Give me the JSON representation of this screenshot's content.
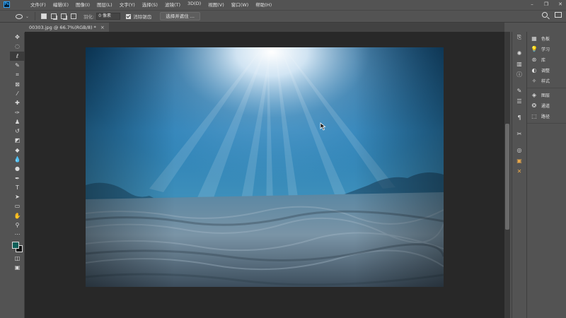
{
  "menu": {
    "app_logo": "Ps",
    "items": [
      "文件(F)",
      "编辑(E)",
      "图像(I)",
      "图层(L)",
      "文字(Y)",
      "选择(S)",
      "滤镜(T)",
      "3D(D)",
      "视图(V)",
      "窗口(W)",
      "帮助(H)"
    ]
  },
  "options": {
    "feather_label": "羽化:",
    "feather_value": "0 像素",
    "antialias_label": "消除锯齿",
    "antialias_checked": true,
    "select_mask_label": "选择并遮住 ..."
  },
  "document": {
    "tab_title": "00303.jpg @ 66.7%(RGB/8) *"
  },
  "panels": {
    "group1": [
      {
        "icon": "grid-icon",
        "label": "色板"
      },
      {
        "icon": "lightbulb-icon",
        "label": "学习"
      },
      {
        "icon": "library-icon",
        "label": "库"
      },
      {
        "icon": "adjustments-icon",
        "label": "调整"
      },
      {
        "icon": "styles-icon",
        "label": "样式"
      }
    ],
    "group2": [
      {
        "icon": "layers-icon",
        "label": "图层"
      },
      {
        "icon": "channels-icon",
        "label": "通道"
      },
      {
        "icon": "paths-icon",
        "label": "路径"
      }
    ]
  },
  "colors": {
    "foreground": "#0f5e58",
    "background": "#111111",
    "accent_ps": "#31a8ff"
  }
}
